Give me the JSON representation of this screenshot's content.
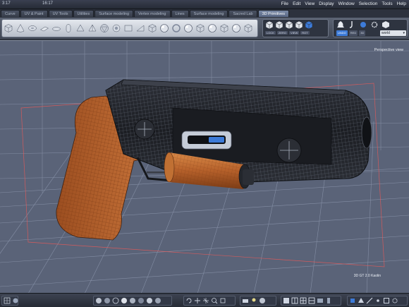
{
  "menubar": {
    "clock_left": "3:17",
    "clock_right": "16:17",
    "menus": [
      "File",
      "Edit",
      "View",
      "Display",
      "Window",
      "Selection",
      "Tools",
      "Help"
    ]
  },
  "tabs": [
    {
      "label": "Curve"
    },
    {
      "label": "UV & Paint"
    },
    {
      "label": "UV Tools"
    },
    {
      "label": "Utilities"
    },
    {
      "label": "Surface modeling"
    },
    {
      "label": "Vertex modeling"
    },
    {
      "label": "Lines"
    },
    {
      "label": "Surface modeling"
    },
    {
      "label": "Sacred Lab"
    },
    {
      "label": "3D Primitives"
    }
  ],
  "active_tab": "3D Primitives",
  "view_panel": {
    "labels": [
      "LOCK",
      "ZERO",
      "VIEW",
      "ROT"
    ]
  },
  "tool_panel": {
    "chips": [
      "UNDO",
      "RED",
      "3D"
    ],
    "space_select": "world"
  },
  "viewport": {
    "view_name": "Perspective view",
    "credit": "3D GT 2.0 Kaolin"
  },
  "colors": {
    "accent": "#3d7bd8",
    "grid_line": "#8f99b0",
    "background": "#5a6378",
    "grip": "#b5602a",
    "body": "#23262c"
  },
  "icons": {
    "primitives": [
      "sphere",
      "cylinder",
      "cube",
      "cone",
      "torus",
      "plane",
      "disc",
      "capsule",
      "prism",
      "pyramid",
      "geosphere",
      "tube",
      "box",
      "wedge",
      "cube",
      "sphere",
      "ring",
      "sphere",
      "cube",
      "sphere",
      "cube",
      "sphere",
      "cube"
    ],
    "view": [
      "view-cube",
      "view-cube",
      "view-cube",
      "view-cube",
      "view-cube"
    ],
    "tools": [
      "bell",
      "hook",
      "dot",
      "gear",
      "cube"
    ]
  }
}
